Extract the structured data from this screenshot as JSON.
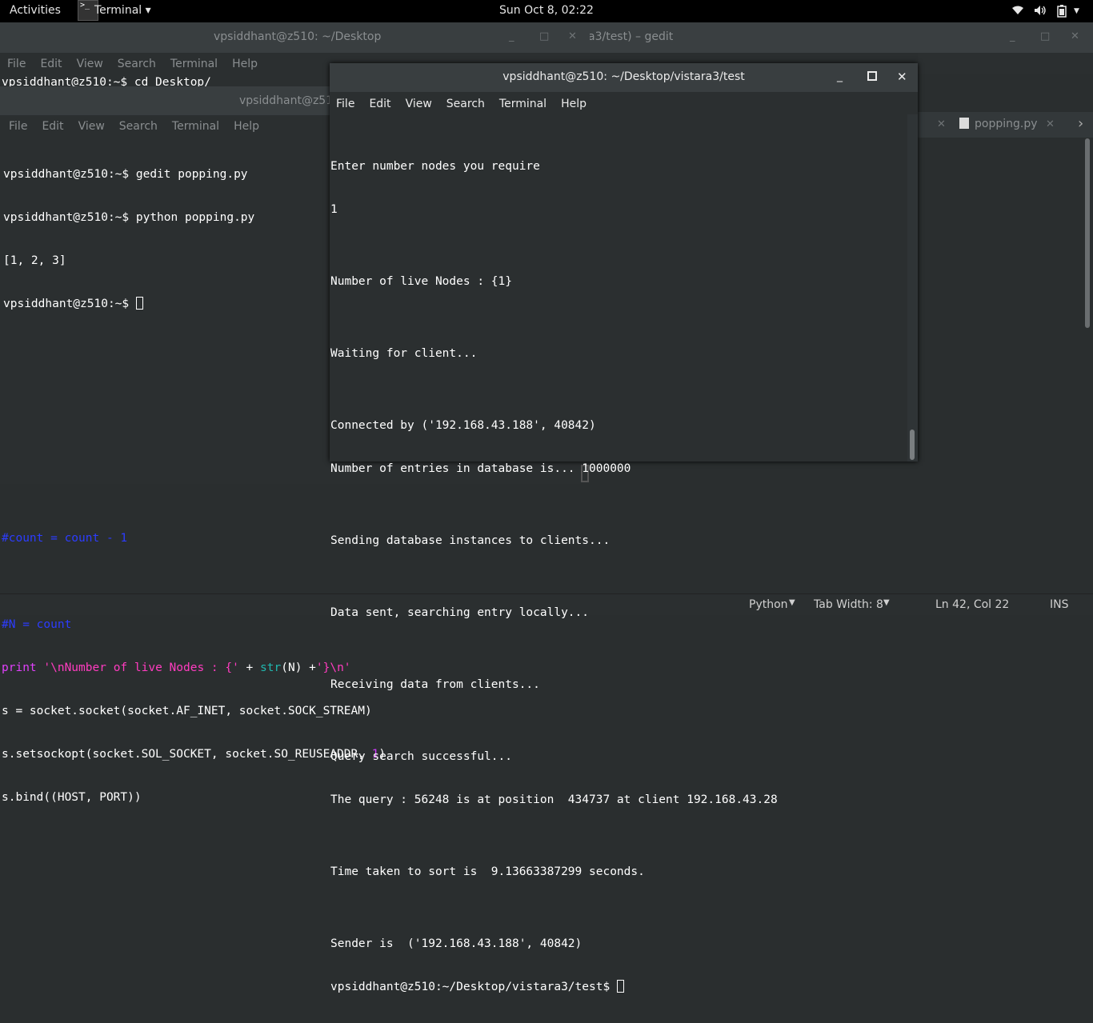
{
  "topbar": {
    "activities": "Activities",
    "app_name": "Terminal ▾",
    "clock": "Sun Oct  8, 02:22"
  },
  "gedit": {
    "title": "a3/test) – gedit",
    "tab_label": "popping.py",
    "code_lines": [
      "#count = count - 1",
      "",
      "#N = count",
      "print '\\nNumber of live Nodes : {' + str(N) +'}\\n'",
      "s = socket.socket(socket.AF_INET, socket.SOCK_STREAM)",
      "s.setsockopt(socket.SOL_SOCKET, socket.SO_REUSEADDR, 1)",
      "s.bind((HOST, PORT))"
    ],
    "status": {
      "language": "Python",
      "tab_width": "Tab Width: 8",
      "position": "Ln 42, Col 22",
      "mode": "INS"
    }
  },
  "term_back": {
    "title": "vpsiddhant@z510: ~/Desktop",
    "menu": [
      "File",
      "Edit",
      "View",
      "Search",
      "Terminal",
      "Help"
    ],
    "partial_line": "vpsiddhant@z510:~$ cd Desktop/"
  },
  "term_mid": {
    "title": "vpsiddhant@z51",
    "menu": [
      "File",
      "Edit",
      "View",
      "Search",
      "Terminal",
      "Help"
    ],
    "lines": [
      "vpsiddhant@z510:~$ gedit popping.py",
      "vpsiddhant@z510:~$ python popping.py",
      "[1, 2, 3]",
      "vpsiddhant@z510:~$ "
    ]
  },
  "term_front": {
    "title": "vpsiddhant@z510: ~/Desktop/vistara3/test",
    "menu": [
      "File",
      "Edit",
      "View",
      "Search",
      "Terminal",
      "Help"
    ],
    "lines": [
      "Enter number nodes you require",
      "1",
      "",
      "Number of live Nodes : {1}",
      "",
      "Waiting for client...",
      "",
      "Connected by ('192.168.43.188', 40842)",
      "Number of entries in database is... 1000000",
      "",
      "Sending database instances to clients...",
      "",
      "Data sent, searching entry locally...",
      "",
      "Receiving data from clients...",
      "",
      "Query search successful...",
      "The query : 56248 is at position  434737 at client 192.168.43.28",
      "",
      "Time taken to sort is  9.13663387299 seconds.",
      "",
      "Sender is  ('192.168.43.188', 40842)"
    ],
    "prompt": "vpsiddhant@z510:~/Desktop/vistara3/test$ "
  }
}
